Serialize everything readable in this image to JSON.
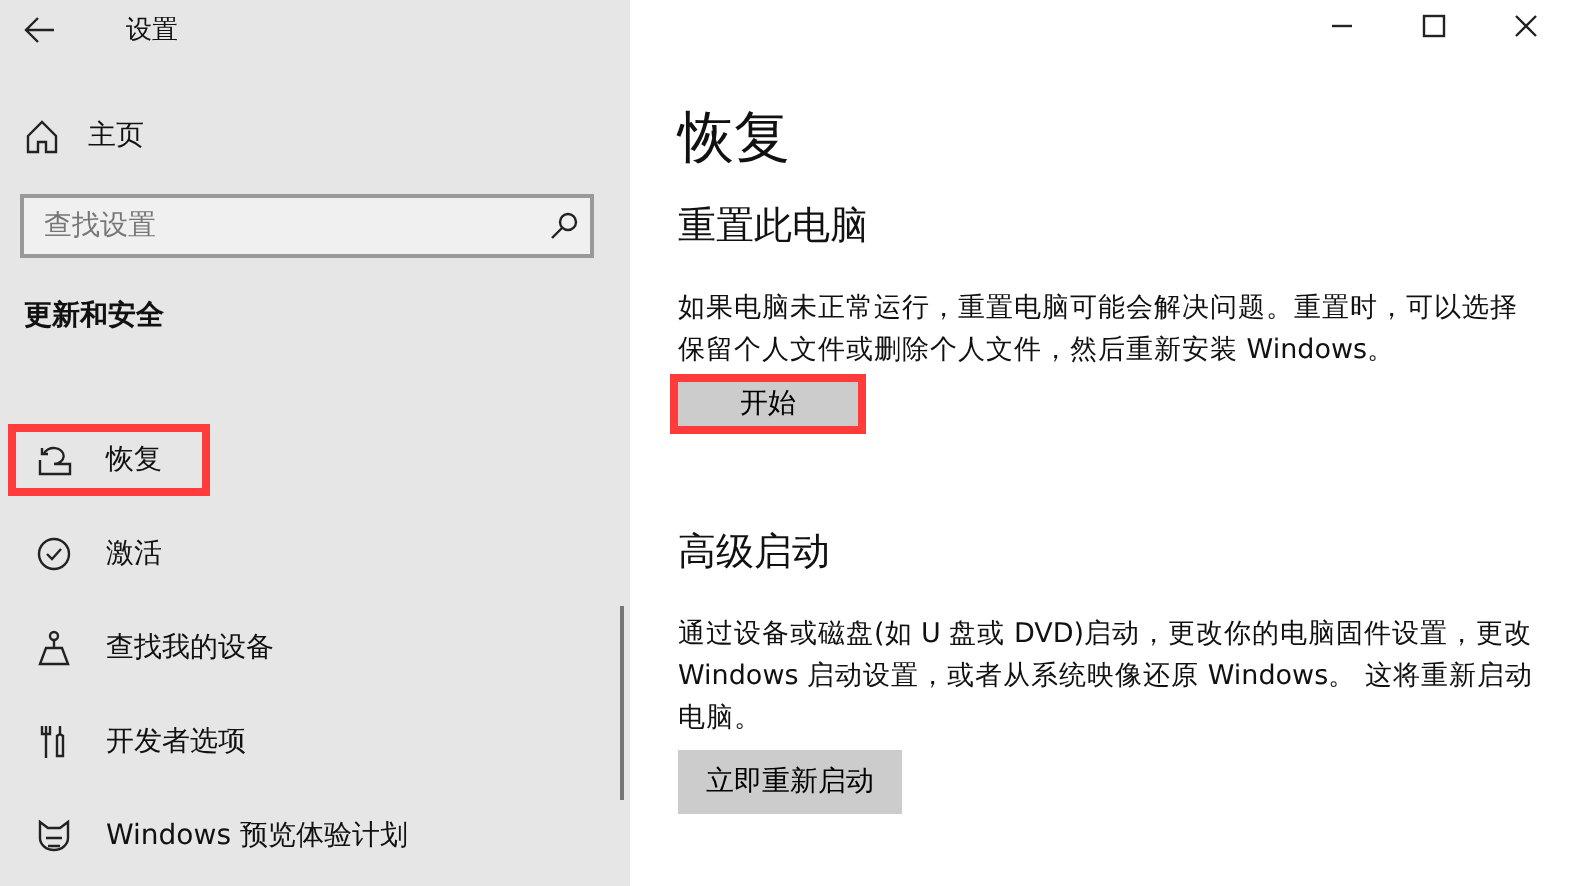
{
  "window": {
    "title": "设置"
  },
  "sidebar": {
    "home": "主页",
    "search": {
      "placeholder": "查找设置"
    },
    "heading": "更新和安全",
    "items": [
      {
        "label": "恢复",
        "kind": "restore",
        "highlighted": true
      },
      {
        "label": "激活",
        "kind": "activation",
        "highlighted": false
      },
      {
        "label": "查找我的设备",
        "kind": "device",
        "highlighted": false
      },
      {
        "label": "开发者选项",
        "kind": "developer",
        "highlighted": false
      },
      {
        "label": "Windows 预览体验计划",
        "kind": "insider",
        "highlighted": false
      }
    ]
  },
  "page": {
    "title": "恢复",
    "sections": [
      {
        "heading": "重置此电脑",
        "text": "如果电脑未正常运行，重置电脑可能会解决问题。重置时，可以选择保留个人文件或删除个人文件，然后重新安装 Windows。",
        "button": "开始",
        "highlighted": true
      },
      {
        "heading": "高级启动",
        "text": "通过设备或磁盘(如 U 盘或 DVD)启动，更改你的电脑固件设置，更改 Windows 启动设置，或者从系统映像还原 Windows。  这将重新启动电脑。",
        "button": "立即重新启动",
        "highlighted": false
      }
    ]
  }
}
